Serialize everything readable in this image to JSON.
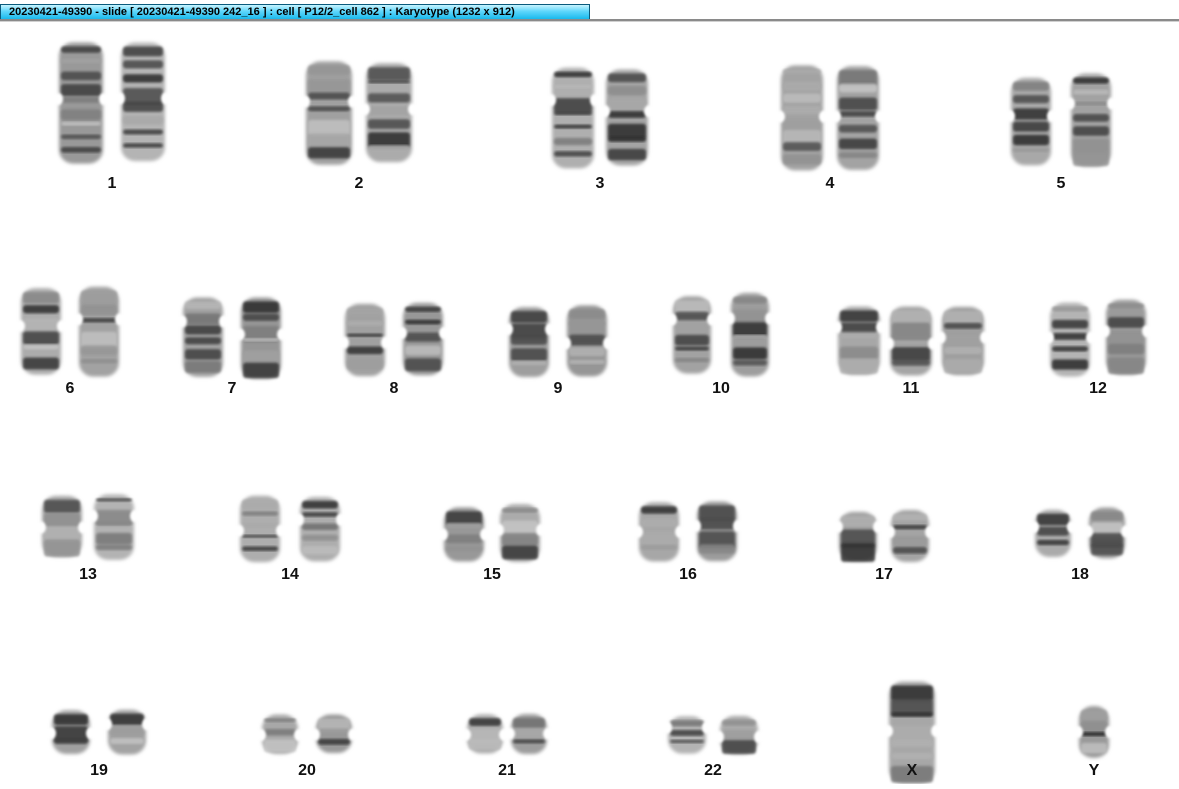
{
  "window": {
    "title": "20230421-49390 - slide [ 20230421-49390 242_16 ] : cell [ P12/2_cell 862 ] : Karyotype  (1232 x 912)"
  },
  "karyotype": {
    "chromosomes": [
      {
        "label": "1",
        "copies": 2
      },
      {
        "label": "2",
        "copies": 2
      },
      {
        "label": "3",
        "copies": 2
      },
      {
        "label": "4",
        "copies": 2
      },
      {
        "label": "5",
        "copies": 2
      },
      {
        "label": "6",
        "copies": 2
      },
      {
        "label": "7",
        "copies": 2
      },
      {
        "label": "8",
        "copies": 2
      },
      {
        "label": "9",
        "copies": 2
      },
      {
        "label": "10",
        "copies": 2
      },
      {
        "label": "11",
        "copies": 3
      },
      {
        "label": "12",
        "copies": 2
      },
      {
        "label": "13",
        "copies": 2
      },
      {
        "label": "14",
        "copies": 2
      },
      {
        "label": "15",
        "copies": 2
      },
      {
        "label": "16",
        "copies": 2
      },
      {
        "label": "17",
        "copies": 2
      },
      {
        "label": "18",
        "copies": 2
      },
      {
        "label": "19",
        "copies": 2
      },
      {
        "label": "20",
        "copies": 2
      },
      {
        "label": "21",
        "copies": 2
      },
      {
        "label": "22",
        "copies": 2
      },
      {
        "label": "X",
        "copies": 1
      },
      {
        "label": "Y",
        "copies": 1
      }
    ]
  }
}
